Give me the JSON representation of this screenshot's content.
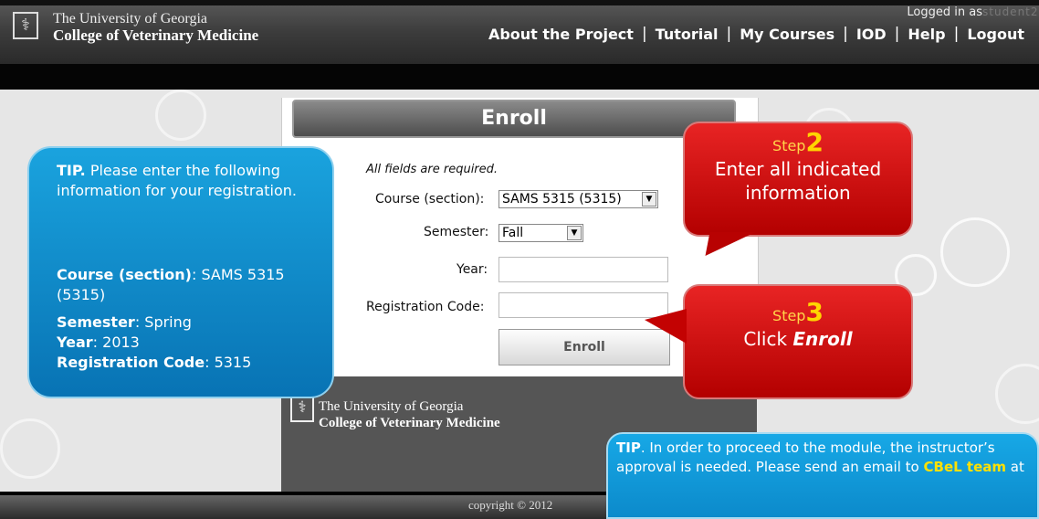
{
  "header": {
    "logo_glyph": "⚕",
    "university": "The University of Georgia",
    "college": "College of Veterinary Medicine",
    "nav": [
      "About the Project",
      "Tutorial",
      "My Courses",
      "IOD",
      "Help",
      "Logout"
    ]
  },
  "login": {
    "label": "Logged in as",
    "user": "student21"
  },
  "form": {
    "title": "Enroll",
    "required_note": "All fields are required.",
    "course_label": "Course (section):",
    "course_value": "SAMS 5315 (5315)",
    "semester_label": "Semester:",
    "semester_value": "Fall",
    "year_label": "Year:",
    "code_label": "Registration Code:",
    "enroll_button": "Enroll"
  },
  "footer": {
    "university": "The University of Georgia",
    "college": "College of Veterinary Medicine",
    "copyright": "copyright © 2012"
  },
  "tip_left": {
    "tip_bold": "TIP.",
    "tip_text": " Please enter the following information for your registration.",
    "course_label": "Course (section)",
    "course_value": ": SAMS 5315 (5315)",
    "semester_label": "Semester",
    "semester_value": ": Spring",
    "year_label": "Year",
    "year_value": ": 2013",
    "code_label": "Registration Code",
    "code_value": ": 5315"
  },
  "step2": {
    "word": "Step",
    "num": "2",
    "desc": "Enter all indicated information"
  },
  "step3": {
    "word": "Step",
    "num": "3",
    "desc_prefix": "Click ",
    "desc_emph": "Enroll"
  },
  "tip_bottom": {
    "tip_bold": "TIP",
    "text1": ". In order to proceed to the module, the instructor’s approval is needed. Please send an email to ",
    "team": "CBeL team",
    "text2": " at"
  },
  "colors": {
    "callout_blue": "#0c8acb",
    "callout_red": "#d40000",
    "highlight_yellow": "#ffe100"
  }
}
